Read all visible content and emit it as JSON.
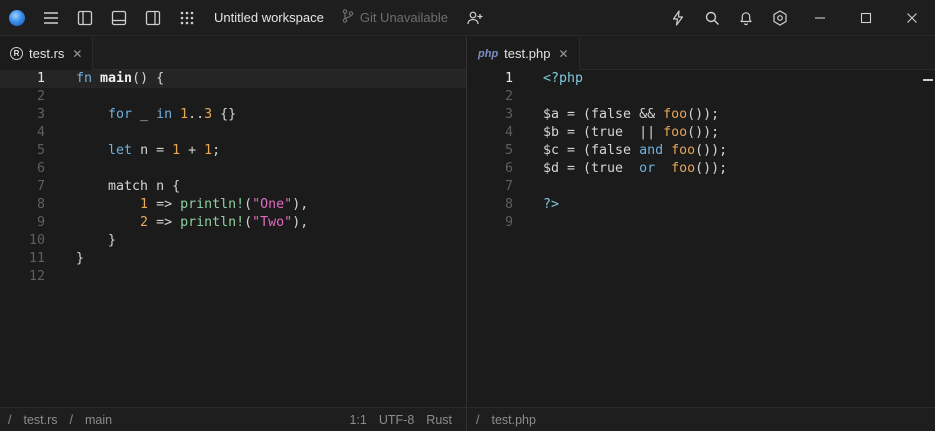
{
  "titlebar": {
    "workspace_title": "Untitled workspace",
    "git_status": "Git Unavailable",
    "icons": [
      "app-logo",
      "menu-icon",
      "left-panel-icon",
      "bottom-panel-icon",
      "right-panel-icon",
      "grid-icon",
      "git-branch-icon",
      "add-user-icon",
      "lightning-icon",
      "search-icon",
      "bell-icon",
      "settings-icon",
      "minimize-icon",
      "maximize-icon",
      "close-icon"
    ]
  },
  "left_pane": {
    "tab": {
      "label": "test.rs",
      "file_type_icon": "rust-icon"
    },
    "status": {
      "path_root": "/",
      "file": "test.rs",
      "symbol": "main",
      "position": "1:1",
      "encoding": "UTF-8",
      "language": "Rust"
    },
    "line_numbers": [
      "1",
      "2",
      "3",
      "4",
      "5",
      "6",
      "7",
      "8",
      "9",
      "10",
      "11",
      "12"
    ],
    "code": {
      "l1_kw": "fn",
      "l1_name": "main",
      "l1_rest": "() {",
      "l3_kw": "for",
      "l3_mid": " _ ",
      "l3_in": "in",
      "l3_sp": " ",
      "l3_n1": "1",
      "l3_range": "..",
      "l3_n2": "3",
      "l3_rest": " {}",
      "l5_kw": "let",
      "l5_mid": " n = ",
      "l5_n1": "1",
      "l5_plus": " + ",
      "l5_n2": "1",
      "l5_end": ";",
      "l7_text": "match n {",
      "l8_num": "1",
      "l8_arrow": " => ",
      "l8_macro": "println!",
      "l8_open": "(",
      "l8_str": "\"One\"",
      "l8_close": "),",
      "l9_num": "2",
      "l9_arrow": " => ",
      "l9_macro": "println!",
      "l9_open": "(",
      "l9_str": "\"Two\"",
      "l9_close": "),",
      "l10_text": "}",
      "l11_text": "}"
    }
  },
  "right_pane": {
    "tab": {
      "label": "test.php",
      "file_type_icon": "php"
    },
    "status": {
      "path_root": "/",
      "file": "test.php"
    },
    "line_numbers": [
      "1",
      "2",
      "3",
      "4",
      "5",
      "6",
      "7",
      "8",
      "9"
    ],
    "code": {
      "l1": "<?php",
      "l3_a": "$a = (false && ",
      "l3_fn": "foo",
      "l3_b": "());",
      "l4_a": "$b = (true  || ",
      "l4_fn": "foo",
      "l4_b": "());",
      "l5_a": "$c = (false ",
      "l5_kw": "and",
      "l5_sp": " ",
      "l5_fn": "foo",
      "l5_b": "());",
      "l6_a": "$d = (true  ",
      "l6_kw": "or",
      "l6_sp": "  ",
      "l6_fn": "foo",
      "l6_b": "());",
      "l8": "?>"
    }
  },
  "colors": {
    "background": "#1b1b1b",
    "keyword": "#6fb0e0",
    "number": "#e8a85a",
    "string": "#e06ac0",
    "macro": "#8fd0a0"
  }
}
